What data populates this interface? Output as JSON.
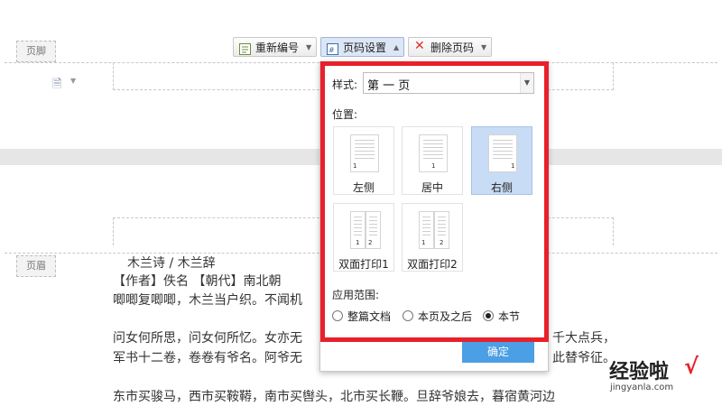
{
  "footer": {
    "tag": "页脚"
  },
  "header": {
    "tag": "页眉"
  },
  "toolbar": {
    "renumber_label": "重新编号",
    "page_setup_label": "页码设置",
    "delete_label": "删除页码"
  },
  "popup": {
    "style_label": "样式:",
    "style_value": "第 一 页",
    "position_label": "位置:",
    "positions": [
      {
        "label": "左侧",
        "num": "1"
      },
      {
        "label": "居中",
        "num": "1"
      },
      {
        "label": "右侧",
        "num": "1"
      },
      {
        "label": "双面打印1",
        "num_left": "1",
        "num_right": "2"
      },
      {
        "label": "双面打印2",
        "num_left": "1",
        "num_right": "2"
      }
    ],
    "selected_position": "右侧",
    "scope_label": "应用范围:",
    "scope_options": [
      "整篇文档",
      "本页及之后",
      "本节"
    ],
    "selected_scope": "本节",
    "ok_label": "确定"
  },
  "document": {
    "title_line": "木兰诗    /    木兰辞",
    "line1": "【作者】佚名   【朝代】南北朝",
    "line2": "唧唧复唧唧，木兰当户织。不闻机",
    "line3a": "问女何所思，问女何所忆。女亦无",
    "line3b": "千大点兵，",
    "line4a": "军书十二卷，卷卷有爷名。阿爷无",
    "line4b": "此替爷征。",
    "line5": "东市买骏马，西市买鞍鞯，南市买辔头，北市买长鞭。旦辞爷娘去，暮宿黄河边"
  },
  "watermark": {
    "text": "经验啦",
    "url": "jingyanla.com",
    "check": "√"
  },
  "colors": {
    "highlight_border": "#e8202a",
    "ok_button": "#4b9fe4",
    "selected_option": "#c9dcf5"
  }
}
